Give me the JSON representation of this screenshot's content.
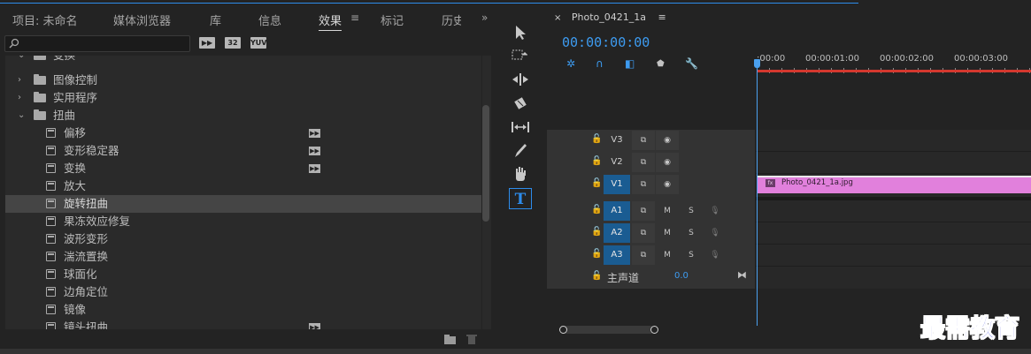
{
  "effects_panel": {
    "tabs": [
      {
        "label": "项目: 未命名"
      },
      {
        "label": "媒体浏览器"
      },
      {
        "label": "库"
      },
      {
        "label": "信息"
      },
      {
        "label": "效果",
        "active": true
      },
      {
        "label": "标记"
      },
      {
        "label": "历史"
      }
    ],
    "tab_menu_icon": "menu-icon",
    "overflow_icon": "double-chevron-right-icon",
    "search": {
      "value": "",
      "icon": "search-icon"
    },
    "filter_buttons": [
      "加速",
      "32",
      "YUV"
    ],
    "tree": [
      {
        "label": "变换",
        "type": "folder",
        "expanded": true,
        "partial": true
      },
      {
        "label": "图像控制",
        "type": "folder",
        "expanded": false
      },
      {
        "label": "实用程序",
        "type": "folder",
        "expanded": false
      },
      {
        "label": "扭曲",
        "type": "folder",
        "expanded": true
      },
      {
        "label": "偏移",
        "type": "effect",
        "accelerated": true
      },
      {
        "label": "变形稳定器",
        "type": "effect",
        "accelerated": true
      },
      {
        "label": "变换",
        "type": "effect",
        "accelerated": true
      },
      {
        "label": "放大",
        "type": "effect",
        "accelerated": false
      },
      {
        "label": "旋转扭曲",
        "type": "effect",
        "accelerated": false,
        "selected": true
      },
      {
        "label": "果冻效应修复",
        "type": "effect",
        "accelerated": false
      },
      {
        "label": "波形变形",
        "type": "effect",
        "accelerated": false
      },
      {
        "label": "湍流置换",
        "type": "effect",
        "accelerated": false
      },
      {
        "label": "球面化",
        "type": "effect",
        "accelerated": false
      },
      {
        "label": "边角定位",
        "type": "effect",
        "accelerated": false
      },
      {
        "label": "镜像",
        "type": "effect",
        "accelerated": false
      },
      {
        "label": "镜头扭曲",
        "type": "effect",
        "accelerated": true
      }
    ],
    "footer_icons": [
      "new-folder-icon",
      "trash-icon"
    ]
  },
  "tools": [
    {
      "name": "selection-tool",
      "glyph": "➤"
    },
    {
      "name": "track-select-tool",
      "glyph": "⇢"
    },
    {
      "name": "ripple-edit-tool",
      "glyph": "✥"
    },
    {
      "name": "razor-tool",
      "glyph": "◆"
    },
    {
      "name": "slip-tool",
      "glyph": "↔"
    },
    {
      "name": "pen-tool",
      "glyph": "✎"
    },
    {
      "name": "hand-tool",
      "glyph": "✋"
    },
    {
      "name": "type-tool",
      "glyph": "T",
      "active": true
    }
  ],
  "timeline": {
    "sequence_tab": {
      "close": "×",
      "name": "Photo_0421_1a",
      "menu": "≡"
    },
    "timecode": "00:00:00:00",
    "ruler_ticks": [
      ":00:00",
      "00:00:01:00",
      "00:00:02:00",
      "00:00:03:00"
    ],
    "video_tracks": [
      {
        "name": "V3",
        "targeted": false
      },
      {
        "name": "V2",
        "targeted": false
      },
      {
        "name": "V1",
        "targeted": true
      }
    ],
    "audio_tracks": [
      {
        "name": "A1",
        "m": "M",
        "s": "S"
      },
      {
        "name": "A2",
        "m": "M",
        "s": "S"
      },
      {
        "name": "A3",
        "m": "M",
        "s": "S"
      }
    ],
    "master": {
      "label": "主声道",
      "value": "0.0"
    },
    "clip": {
      "name": "Photo_0421_1a.jpg",
      "fx": "fx",
      "color": "#e180dc"
    }
  },
  "watermark": "最需教育",
  "colors": {
    "accent": "#2d8ceb",
    "playhead": "#4aa0ef",
    "clip": "#e180dc",
    "track_target": "#1a5c92",
    "work_area": "#d4382e"
  }
}
